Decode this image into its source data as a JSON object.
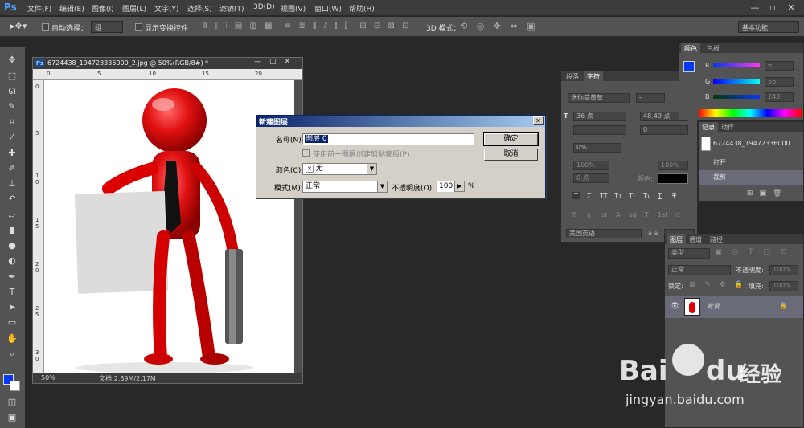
{
  "app": {
    "logo": "Ps"
  },
  "menubar": {
    "items": [
      "文件(F)",
      "编辑(E)",
      "图像(I)",
      "图层(L)",
      "文字(Y)",
      "选择(S)",
      "滤镜(T)",
      "3D(D)",
      "视图(V)",
      "窗口(W)",
      "帮助(H)"
    ],
    "window_controls": [
      "—",
      "▫",
      "✕"
    ]
  },
  "options_bar": {
    "auto_select_label": "自动选择：",
    "auto_select_value": "组",
    "show_transform_label": "显示变换控件",
    "mode_3d_label": "3D 模式：",
    "workspace": "基本功能"
  },
  "document": {
    "title": "6724438_194723336000_2.jpg @ 50%(RGB/8#) *",
    "zoom": "50%",
    "doc_size": "文档:2.39M/2.17M",
    "ruler_h": [
      "0",
      "5",
      "10",
      "15",
      "20"
    ],
    "ruler_v": [
      "0",
      "5",
      "1 0",
      "1 5",
      "2 0",
      "2 5",
      "3 0"
    ]
  },
  "dialog": {
    "title": "新建图层",
    "name_label": "名称(N):",
    "name_value": "图层 0",
    "clip_label": "使用前一图层创建剪贴蒙版(P)",
    "color_label": "颜色(C):",
    "color_value": "无",
    "mode_label": "模式(M):",
    "mode_value": "正常",
    "opacity_label": "不透明度(O):",
    "opacity_value": "100",
    "opacity_unit": "%",
    "ok": "确定",
    "cancel": "取消"
  },
  "color_panel": {
    "tabs": [
      "颜色",
      "色板"
    ],
    "r_label": "R",
    "r_value": "6",
    "g_label": "G",
    "g_value": "56",
    "b_label": "B",
    "b_value": "243",
    "swatch": "#0638f3"
  },
  "char_panel": {
    "tabs": [
      "段落",
      "字符"
    ],
    "font": "迷你简黄草",
    "style": "-",
    "size": "36 点",
    "leading": "48.49 点",
    "tracking": "0",
    "scale_v": "0%",
    "scale_h1": "100%",
    "scale_h2": "100%",
    "baseline": "0 点",
    "color_label": "颜色:",
    "lang": "美国英语",
    "aa": "a a",
    "style_buttons": [
      "T",
      "T",
      "TT",
      "Tт",
      "T¹",
      "T₁",
      "T",
      "T"
    ],
    "ot_buttons": [
      "fi",
      "ꝺ",
      "st",
      "A",
      "aā",
      "T",
      "1st",
      "½"
    ]
  },
  "history_panel": {
    "tabs": [
      "记录",
      "动作"
    ],
    "snapshot": "6724438_19472336000...",
    "items": [
      "打开",
      "裁剪"
    ]
  },
  "layers_panel": {
    "tabs": [
      "图层",
      "通道",
      "路径"
    ],
    "filter": "类型",
    "blend": "正常",
    "opacity_label": "不透明度:",
    "opacity": "100%",
    "lock_label": "锁定:",
    "fill_label": "填充:",
    "fill": "100%",
    "layer_name": "背景"
  },
  "watermark": {
    "brand": "Bai",
    "brand2": "du",
    "cn": "经验",
    "url": "jingyan.baidu.com"
  }
}
